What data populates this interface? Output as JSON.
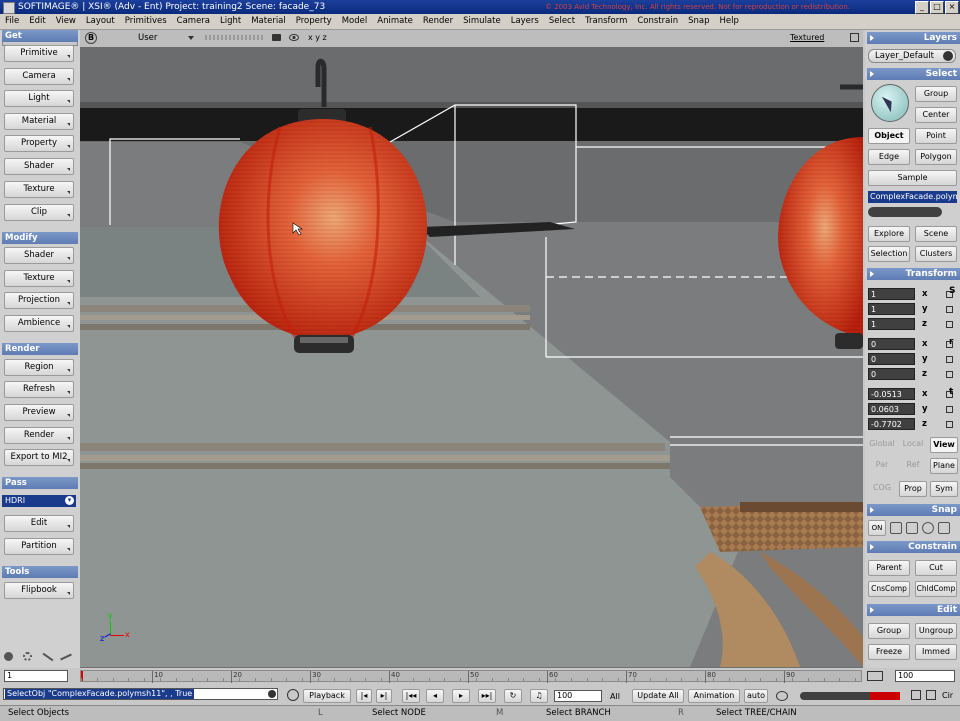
{
  "window": {
    "title": "SOFTIMAGE® | XSI® (Adv - Ent) Project: training2     Scene: facade_73",
    "copyright": "© 2003 Avid Technology, Inc. All rights reserved.  Not for reproduction or redistribution.",
    "controls": {
      "minimize": "_",
      "maximize": "□",
      "close": "×"
    }
  },
  "menu": [
    "File",
    "Edit",
    "View",
    "Layout",
    "Primitives",
    "Camera",
    "Light",
    "Material",
    "Property",
    "Model",
    "Animate",
    "Render",
    "Simulate",
    "Layers",
    "Select",
    "Transform",
    "Constrain",
    "Snap",
    "Help"
  ],
  "left_panel": {
    "mode": "Render",
    "sections": [
      {
        "header": "Get",
        "buttons": [
          "Primitive",
          "Camera",
          "Light",
          "Material",
          "Property",
          "Shader",
          "Texture",
          "Clip"
        ]
      },
      {
        "header": "Modify",
        "buttons": [
          "Shader",
          "Texture",
          "Projection",
          "Ambience"
        ]
      },
      {
        "header": "Render",
        "buttons": [
          "Region",
          "Refresh",
          "Preview",
          "Render",
          "Export to MI2"
        ]
      },
      {
        "header": "Pass",
        "select": "HDRI",
        "buttons": [
          "Edit",
          "Partition"
        ]
      },
      {
        "header": "Tools",
        "buttons": [
          "Flipbook"
        ]
      }
    ]
  },
  "viewport": {
    "camera": "User",
    "display_mode": "Textured",
    "axes": {
      "x": "x",
      "y": "y",
      "z": "z"
    },
    "axis_labels": "x y z"
  },
  "right_panel": {
    "layers_header": "Layers",
    "layer": "Layer_Default",
    "select_header": "Select",
    "group": "Group",
    "center": "Center",
    "object": "Object",
    "point": "Point",
    "edge": "Edge",
    "polygon": "Polygon",
    "sample": "Sample",
    "selected_name": "ComplexFacade.polymsh11",
    "explore": "Explore",
    "scene": "Scene",
    "selection": "Selection",
    "clusters": "Clusters",
    "transform_header": "Transform",
    "scale": [
      {
        "v": "1",
        "a": "x"
      },
      {
        "v": "1",
        "a": "y"
      },
      {
        "v": "1",
        "a": "z"
      }
    ],
    "rotate": [
      {
        "v": "0",
        "a": "x"
      },
      {
        "v": "0",
        "a": "y"
      },
      {
        "v": "0",
        "a": "z"
      }
    ],
    "translate": [
      {
        "v": "-0.0513",
        "a": "x"
      },
      {
        "v": "0.0603",
        "a": "y"
      },
      {
        "v": "-0.7702",
        "a": "z"
      }
    ],
    "side_letters": {
      "s": "S",
      "r": "r",
      "t": "t"
    },
    "global": "Global",
    "local": "Local",
    "view": "View",
    "par": "Par",
    "ref": "Ref",
    "plane": "Plane",
    "cog": "COG",
    "prop": "Prop",
    "sym": "Sym",
    "snap_header": "Snap",
    "snap_on": "ON",
    "constrain_header": "Constrain",
    "parent": "Parent",
    "cut": "Cut",
    "cnscomp": "CnsComp",
    "chldcomp": "ChldComp",
    "edit_header": "Edit",
    "egroup": "Group",
    "ungroup": "Ungroup",
    "freeze": "Freeze",
    "immed": "Immed"
  },
  "timeline": {
    "start": "1",
    "end": "100",
    "ticks": [
      "10",
      "20",
      "30",
      "40",
      "50",
      "60",
      "70",
      "80",
      "90"
    ]
  },
  "playback": {
    "command": "SelectObj \"ComplexFacade.polymsh11\", , True",
    "playback": "Playback",
    "frame": "100",
    "all": "All",
    "update_all": "Update All",
    "animation": "Animation",
    "auto": "auto",
    "cir": "Cir"
  },
  "status": {
    "left": "Select Objects",
    "l": "L",
    "select_node": "Select NODE",
    "m": "M",
    "select_branch": "Select BRANCH",
    "r": "R",
    "select_tree": "Select TREE/CHAIN"
  },
  "colors": {
    "accent": "#5e7cb4",
    "lantern": "#d43a1e",
    "selection": "#1a3a8c"
  }
}
